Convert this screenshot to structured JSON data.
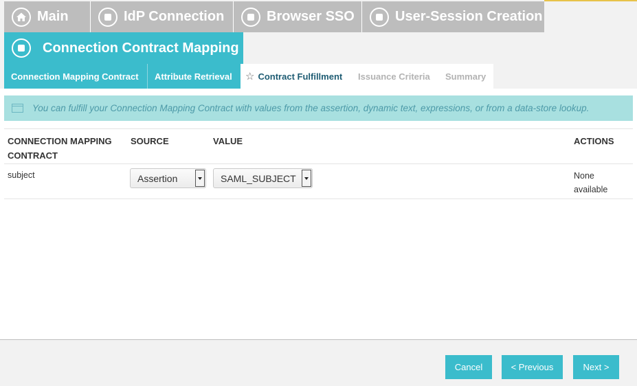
{
  "colors": {
    "accent": "#3bbccc",
    "inactive_tab": "#bdbdbd",
    "banner_bg": "#a8e0e0"
  },
  "top_tabs": [
    {
      "label": "Main",
      "icon": "home-icon"
    },
    {
      "label": "IdP Connection",
      "icon": "circle-stop-icon"
    },
    {
      "label": "Browser SSO",
      "icon": "circle-stop-icon"
    },
    {
      "label": "User-Session Creation",
      "icon": "circle-stop-icon"
    }
  ],
  "current_step": {
    "label": "Connection Contract Mapping",
    "icon": "circle-stop-icon"
  },
  "sub_tabs": [
    {
      "label": "Connection Mapping Contract",
      "state": "completed"
    },
    {
      "label": "Attribute Retrieval",
      "state": "completed"
    },
    {
      "label": "Contract Fulfillment",
      "state": "active",
      "icon": "star-icon"
    },
    {
      "label": "Issuance Criteria",
      "state": "pending"
    },
    {
      "label": "Summary",
      "state": "pending"
    }
  ],
  "info_banner": {
    "icon": "info-panel-icon",
    "text": "You can fulfill your Connection Mapping Contract with values from the assertion, dynamic text, expressions, or from a data-store lookup."
  },
  "table": {
    "headers": {
      "contract_line1": "CONNECTION MAPPING",
      "contract_line2": "CONTRACT",
      "source": "SOURCE",
      "value": "VALUE",
      "actions": "ACTIONS"
    },
    "rows": [
      {
        "contract": "subject",
        "source": "Assertion",
        "value": "SAML_SUBJECT",
        "actions_line1": "None",
        "actions_line2": "available"
      }
    ]
  },
  "footer": {
    "cancel_label": "Cancel",
    "previous_label": "< Previous",
    "next_label": "Next >"
  }
}
